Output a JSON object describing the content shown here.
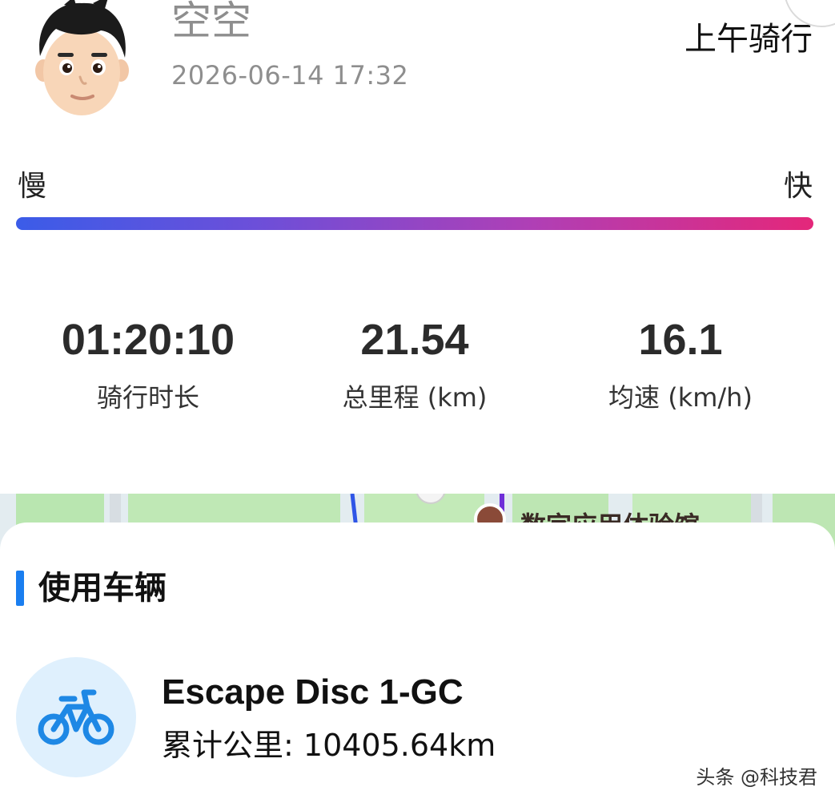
{
  "header": {
    "username": "空空",
    "datetime": "2026-06-14 17:32",
    "ride_name": "上午骑行"
  },
  "speed_legend": {
    "slow_label": "慢",
    "fast_label": "快",
    "gradient_start": "#3b5ce8",
    "gradient_end": "#e4277a"
  },
  "stats": [
    {
      "value": "01:20:10",
      "label": "骑行时长"
    },
    {
      "value": "21.54",
      "label": "总里程 (km)"
    },
    {
      "value": "16.1",
      "label": "均速 (km/h)"
    }
  ],
  "map": {
    "poi_label": "数字应用体验馆"
  },
  "vehicle_section": {
    "title": "使用车辆",
    "accent_color": "#1a7ef0",
    "icon": "bicycle-icon",
    "vehicle_name": "Escape Disc 1-GC",
    "odometer_label": "累计公里:",
    "odometer_value": "10405.64km"
  },
  "watermark": "头条 @科技君"
}
